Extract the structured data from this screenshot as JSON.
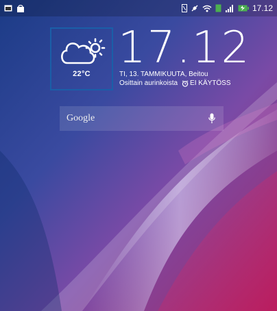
{
  "status_bar": {
    "time": "17.12",
    "left_icons": [
      "screenshot-icon",
      "bag-icon"
    ],
    "right_icons": [
      "nfc-icon",
      "no-sound-icon",
      "wifi-icon",
      "sim-icon",
      "signal-icon",
      "battery-charging-icon"
    ]
  },
  "weather": {
    "temperature": "22°C",
    "icon": "partly-sunny-icon"
  },
  "clock": {
    "time": "17.12",
    "date_location": "TI, 13. TAMMIKUUTA, Beitou",
    "condition": "Osittain aurinkoista",
    "alarm": "EI KÄYTÖSS"
  },
  "search": {
    "label": "Google",
    "mic_icon": "mic-icon"
  }
}
